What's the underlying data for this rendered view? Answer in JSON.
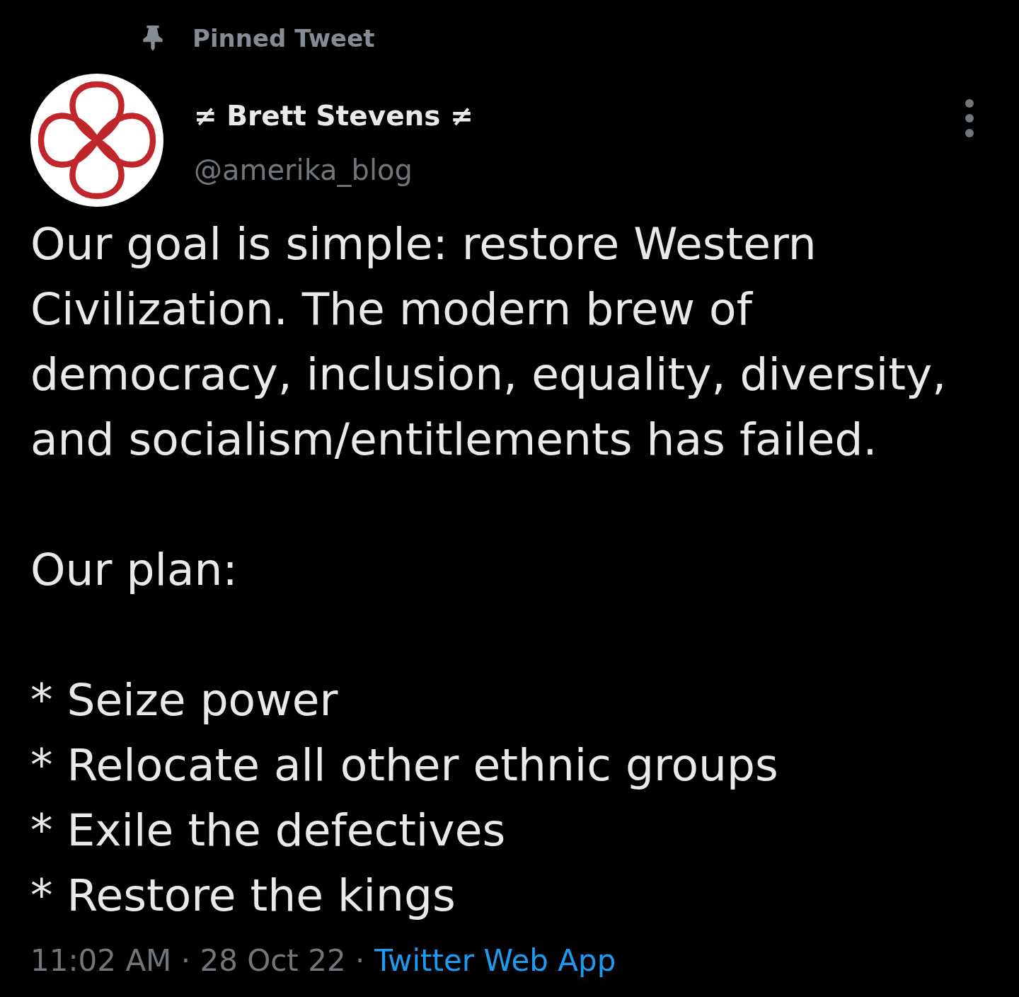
{
  "pinned": {
    "label": "Pinned Tweet"
  },
  "author": {
    "name": "≠ Brett Stevens ≠",
    "handle": "@amerika_blog"
  },
  "tweet": {
    "text": "Our goal is simple: restore Western Civilization. The modern brew of democracy, inclusion, equality, diversity, and socialism/entitlements has failed.\n\nOur plan:\n\n* Seize power\n* Relocate all other ethnic groups\n* Exile the defectives\n* Restore the kings"
  },
  "footer": [
    {
      "kind": "meta",
      "text": "11:02 AM · 28 Oct 22 ·"
    },
    {
      "kind": "link",
      "text": "Twitter Web App"
    }
  ]
}
